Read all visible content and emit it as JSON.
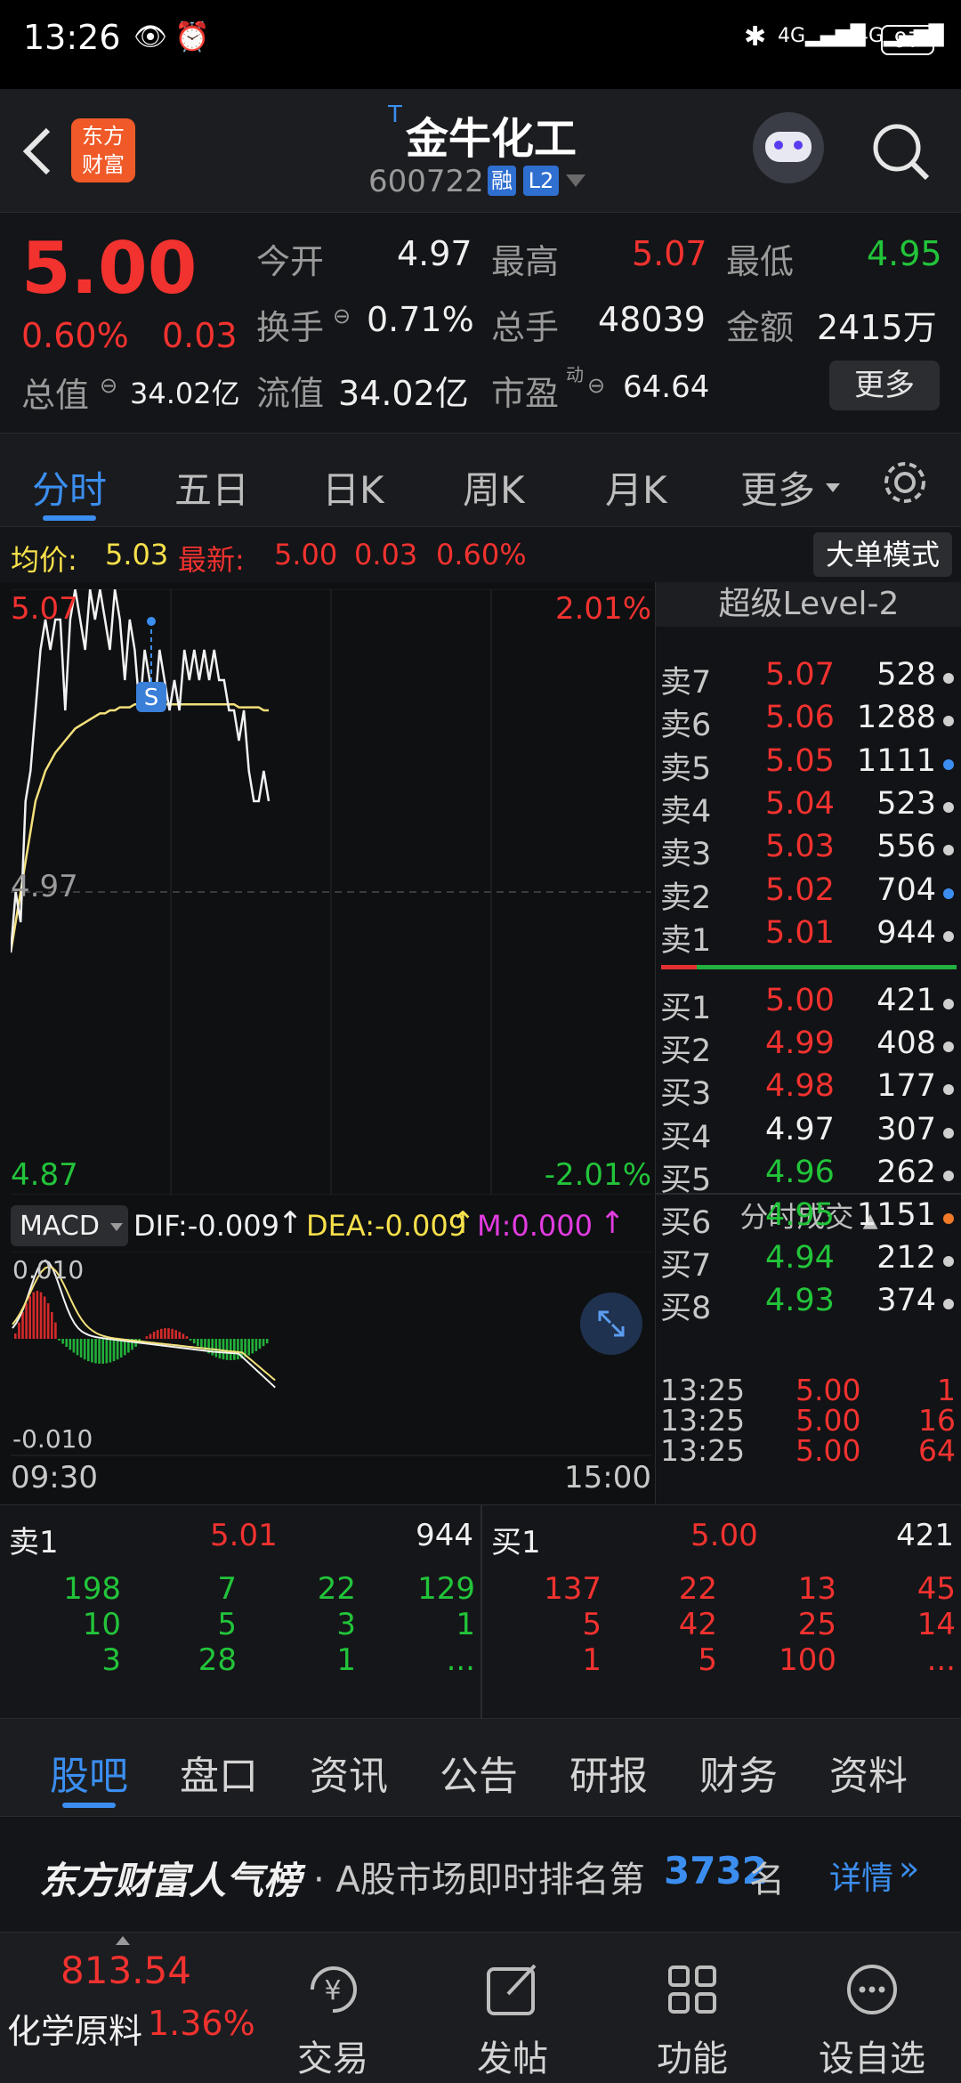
{
  "status_bar": {
    "time": "13:26",
    "battery": "97"
  },
  "header": {
    "logo_line1": "东方",
    "logo_line2": "财富",
    "tag": "T",
    "stock_name": "金牛化工",
    "stock_code": "600722",
    "badge_rong": "融",
    "badge_l2": "L2"
  },
  "quote": {
    "price": "5.00",
    "change_pct": "0.60%",
    "change": "0.03",
    "open_label": "今开",
    "open_value": "4.97",
    "high_label": "最高",
    "high_value": "5.07",
    "low_label": "最低",
    "low_value": "4.95",
    "turnover_label": "换手",
    "turnover_value": "0.71%",
    "volume_label": "总手",
    "volume_value": "48039",
    "amount_label": "金额",
    "amount_value": "2415万",
    "total_cap_label": "总值",
    "total_cap_value": "34.02亿",
    "float_cap_label": "流值",
    "float_cap_value": "34.02亿",
    "pe_label": "市盈",
    "pe_sup": "动",
    "pe_value": "64.64",
    "more_button": "更多"
  },
  "chart_tabs": [
    "分时",
    "五日",
    "日K",
    "周K",
    "月K",
    "更多"
  ],
  "info_row": {
    "avg_label": "均价:",
    "avg_value": "5.03",
    "latest_label": "最新:",
    "latest_value": "5.00",
    "latest_change": "0.03",
    "latest_pct": "0.60%",
    "big_order_button": "大单模式"
  },
  "chart_labels": {
    "top_price": "5.07",
    "top_pct": "2.01%",
    "mid_price": "4.97",
    "bottom_price": "4.87",
    "bottom_pct": "-2.01%",
    "time_start": "09:30",
    "time_end": "15:00",
    "signal": "S"
  },
  "macd": {
    "selector": "MACD",
    "dif": "DIF:-0.009",
    "dea": "DEA:-0.009",
    "m": "M:0.000",
    "axis_top": "0.010",
    "axis_bottom": "-0.010"
  },
  "level2_title": "超级Level-2",
  "sell_orders": [
    {
      "label": "卖7",
      "price": "5.07",
      "volume": "528",
      "color": "red"
    },
    {
      "label": "卖6",
      "price": "5.06",
      "volume": "1288",
      "color": "red"
    },
    {
      "label": "卖5",
      "price": "5.05",
      "volume": "1111",
      "color": "red"
    },
    {
      "label": "卖4",
      "price": "5.04",
      "volume": "523",
      "color": "red"
    },
    {
      "label": "卖3",
      "price": "5.03",
      "volume": "556",
      "color": "red"
    },
    {
      "label": "卖2",
      "price": "5.02",
      "volume": "704",
      "color": "red"
    },
    {
      "label": "卖1",
      "price": "5.01",
      "volume": "944",
      "color": "red"
    }
  ],
  "buy_orders": [
    {
      "label": "买1",
      "price": "5.00",
      "volume": "421",
      "color": "red"
    },
    {
      "label": "买2",
      "price": "4.99",
      "volume": "408",
      "color": "red"
    },
    {
      "label": "买3",
      "price": "4.98",
      "volume": "177",
      "color": "red"
    },
    {
      "label": "买4",
      "price": "4.97",
      "volume": "307",
      "color": "white"
    },
    {
      "label": "买5",
      "price": "4.96",
      "volume": "262",
      "color": "green"
    },
    {
      "label": "买6",
      "price": "4.95",
      "volume": "1151",
      "color": "green"
    },
    {
      "label": "买7",
      "price": "4.94",
      "volume": "212",
      "color": "green"
    },
    {
      "label": "买8",
      "price": "4.93",
      "volume": "374",
      "color": "green"
    }
  ],
  "trades_title": "分时成交",
  "trades": [
    {
      "time": "13:25",
      "price": "5.00",
      "volume": "1"
    },
    {
      "time": "13:25",
      "price": "5.00",
      "volume": "16"
    },
    {
      "time": "13:25",
      "price": "5.00",
      "volume": "64"
    }
  ],
  "order_queue": {
    "sell_label": "卖1",
    "sell_price": "5.01",
    "sell_volume": "944",
    "buy_label": "买1",
    "buy_price": "5.00",
    "buy_volume": "421",
    "sell_rows": [
      [
        "198",
        "7",
        "22",
        "129"
      ],
      [
        "10",
        "5",
        "3",
        "1"
      ],
      [
        "3",
        "28",
        "1",
        "..."
      ]
    ],
    "buy_rows": [
      [
        "137",
        "22",
        "13",
        "45"
      ],
      [
        "5",
        "42",
        "25",
        "14"
      ],
      [
        "1",
        "5",
        "100",
        "..."
      ]
    ]
  },
  "bottom_tabs": [
    "股吧",
    "盘口",
    "资讯",
    "公告",
    "研报",
    "财务",
    "资料"
  ],
  "rank": {
    "brand": "东方财富人气榜",
    "text_before": "· A股市场即时排名第",
    "rank_value": "3732",
    "text_after": "名",
    "detail": "详情"
  },
  "nav": {
    "index_value": "813.54",
    "index_name": "化学原料",
    "index_pct": "1.36%",
    "items": [
      "交易",
      "发帖",
      "功能",
      "设自选"
    ]
  },
  "chart_data": {
    "type": "line",
    "title": "",
    "y_range": [
      4.87,
      5.07
    ],
    "reference_price": 4.97,
    "series": [
      {
        "name": "",
        "values": [
          4.95,
          4.97,
          4.96,
          5.0,
          5.01,
          5.03,
          5.05,
          5.06,
          5.05,
          5.06,
          5.06,
          5.03,
          5.06,
          5.07,
          5.06,
          5.05,
          5.07,
          5.06,
          5.07,
          5.06,
          5.05,
          5.07,
          5.06,
          5.04,
          5.06,
          5.05,
          5.03,
          5.05,
          5.04,
          5.03,
          5.05,
          5.04,
          5.03,
          5.04,
          5.03,
          5.05,
          5.04,
          5.05,
          5.04,
          5.05,
          5.04,
          5.05,
          5.04,
          5.04,
          5.03,
          5.03,
          5.02,
          5.03,
          5.01,
          5.0,
          5.0,
          5.01,
          5.0
        ]
      },
      {
        "name": "均价",
        "values": [
          4.95,
          4.96,
          4.97,
          4.98,
          4.99,
          5.0,
          5.005,
          5.01,
          5.013,
          5.016,
          5.018,
          5.02,
          5.022,
          5.024,
          5.025,
          5.026,
          5.027,
          5.028,
          5.029,
          5.029,
          5.03,
          5.03,
          5.031,
          5.031,
          5.031,
          5.032,
          5.032,
          5.032,
          5.032,
          5.032,
          5.032,
          5.032,
          5.032,
          5.032,
          5.032,
          5.032,
          5.032,
          5.032,
          5.032,
          5.032,
          5.032,
          5.032,
          5.032,
          5.032,
          5.032,
          5.032,
          5.031,
          5.031,
          5.031,
          5.031,
          5.031,
          5.03,
          5.03
        ]
      }
    ]
  }
}
